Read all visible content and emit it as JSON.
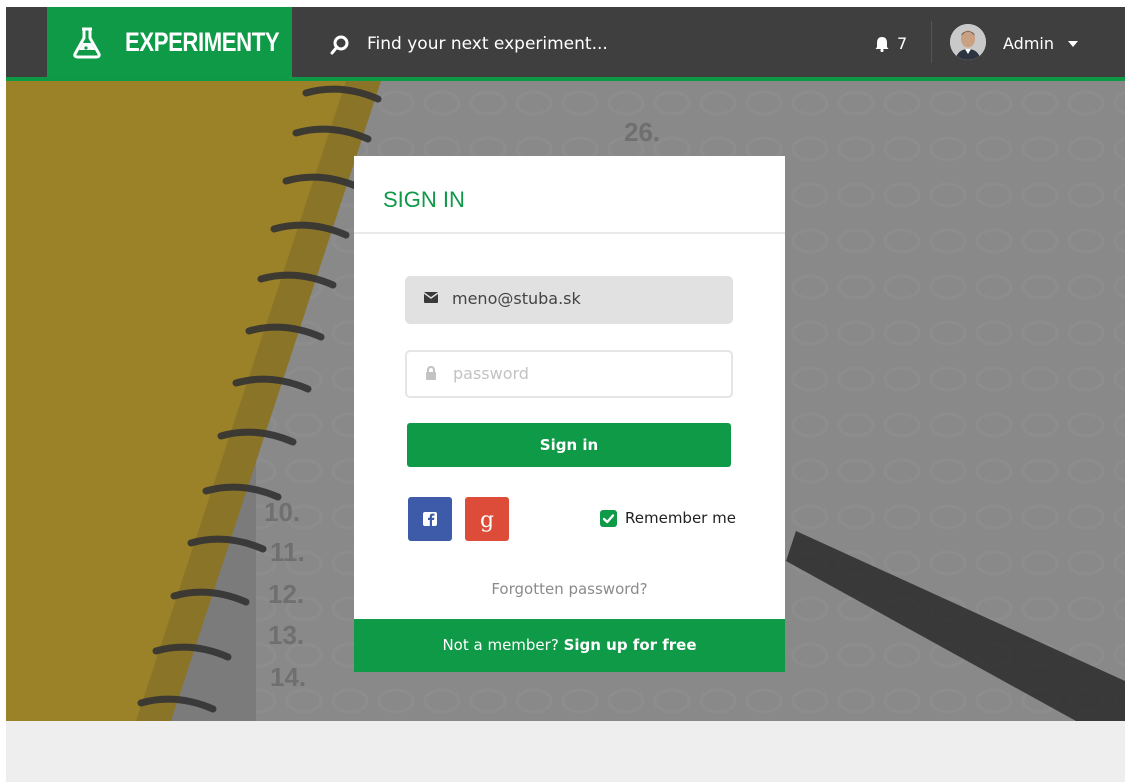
{
  "navbar": {
    "brand_name": "EXPERIMENTY",
    "search_placeholder": "Find your next experiment...",
    "notification_count": "7",
    "user_name": "Admin",
    "icons": [
      "flask-icon",
      "search-icon",
      "bell-icon",
      "avatar",
      "caret-down-icon"
    ]
  },
  "login": {
    "title": "SIGN IN",
    "email_value": "meno@stuba.sk",
    "password_placeholder": "password",
    "signin_label": "Sign in",
    "remember_label": "Remember me",
    "forgot_label": "Forgotten password?",
    "footer_text": "Not a member?",
    "footer_link": "Sign up for free",
    "social": [
      "facebook-icon",
      "google-plus-icon"
    ]
  },
  "colors": {
    "brand_green": "#0e9a47",
    "navbar_bg": "#3f3f3f",
    "facebook_blue": "#3d5ba9",
    "google_red": "#dd4b39",
    "page_bg": "#eeeeee"
  }
}
